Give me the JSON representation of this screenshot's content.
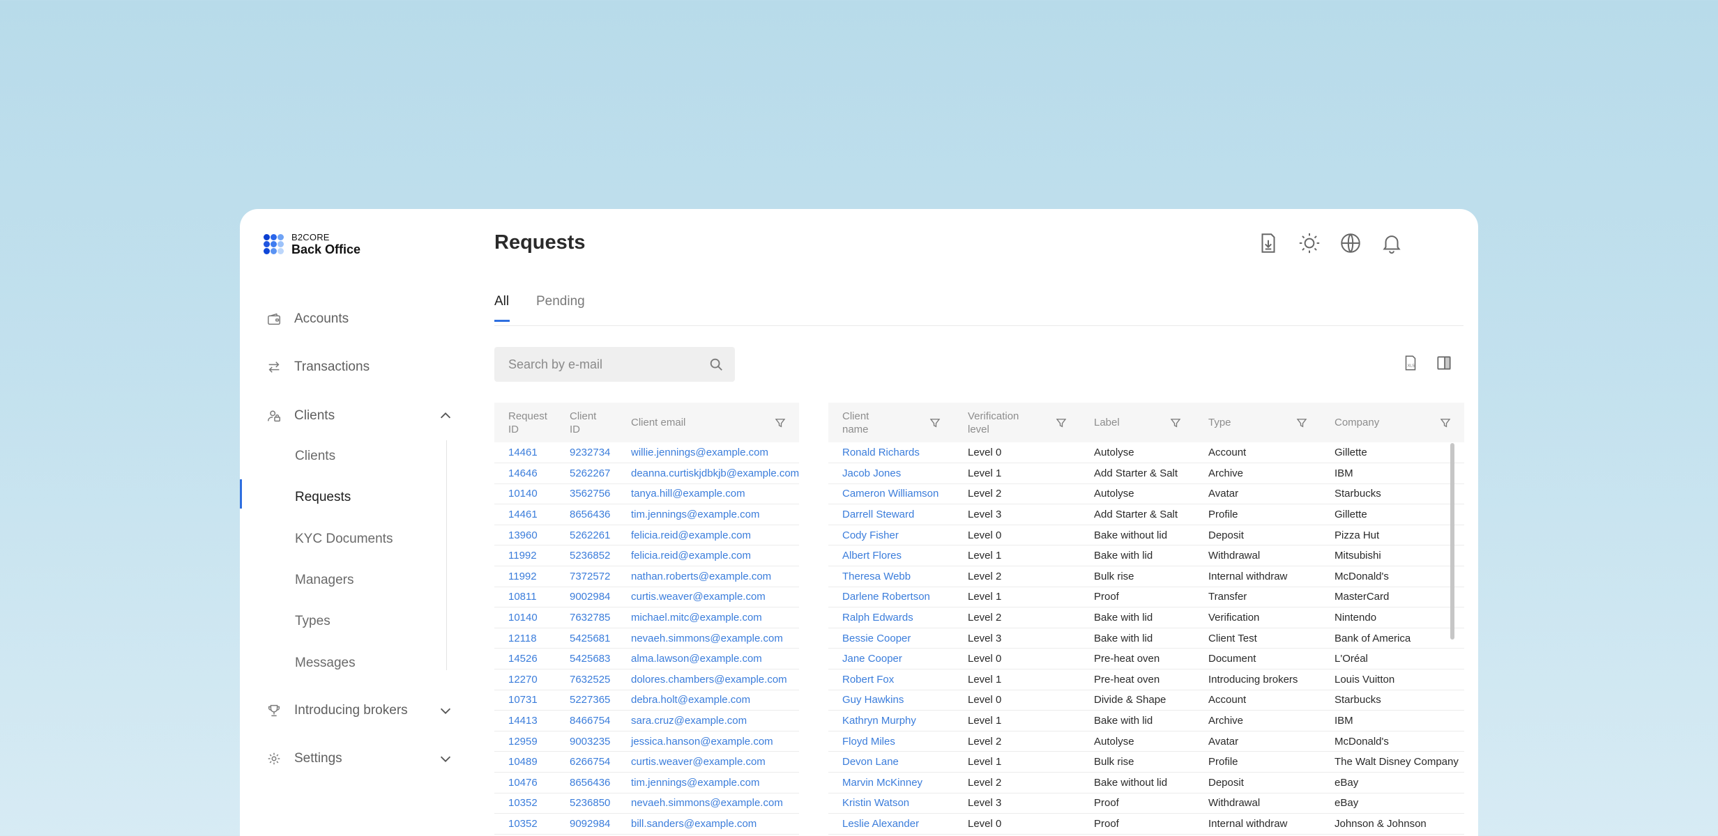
{
  "app": {
    "brand_small": "B2CORE",
    "brand_big": "Back Office"
  },
  "sidebar": {
    "items": [
      {
        "label": "Accounts",
        "icon": "wallet-icon"
      },
      {
        "label": "Transactions",
        "icon": "transfer-arrows-icon"
      },
      {
        "label": "Clients",
        "icon": "clients-icon",
        "expanded": true
      },
      {
        "label": "Introducing brokers",
        "icon": "trophy-icon",
        "expanded": false
      },
      {
        "label": "Settings",
        "icon": "gear-icon",
        "expanded": false
      }
    ],
    "clients_sub": [
      "Clients",
      "Requests",
      "KYC Documents",
      "Managers",
      "Types",
      "Messages"
    ],
    "active_sub": "Requests"
  },
  "header": {
    "title": "Requests",
    "icons": [
      "download-document-icon",
      "sun-icon",
      "globe-icon",
      "bell-icon"
    ]
  },
  "tabs": [
    {
      "label": "All",
      "active": true
    },
    {
      "label": "Pending",
      "active": false
    }
  ],
  "search": {
    "placeholder": "Search by e-mail",
    "value": ""
  },
  "toolbar": {
    "icons": [
      "xls-export-icon",
      "columns-icon"
    ]
  },
  "table": {
    "columns_left": [
      "Request ID",
      "Client ID",
      "Client email"
    ],
    "columns_right": [
      "Client name",
      "Verification level",
      "Label",
      "Type",
      "Company"
    ],
    "rows": [
      [
        "14461",
        "9232734",
        "willie.jennings@example.com",
        "Ronald Richards",
        "Level 0",
        "Autolyse",
        "Account",
        "Gillette"
      ],
      [
        "14646",
        "5262267",
        "deanna.curtiskjdbkjb@example.com",
        "Jacob Jones",
        "Level 1",
        "Add Starter & Salt",
        "Archive",
        "IBM"
      ],
      [
        "10140",
        "3562756",
        "tanya.hill@example.com",
        "Cameron Williamson",
        "Level 2",
        "Autolyse",
        "Avatar",
        "Starbucks"
      ],
      [
        "14461",
        "8656436",
        "tim.jennings@example.com",
        "Darrell Steward",
        "Level 3",
        "Add Starter & Salt",
        "Profile",
        "Gillette"
      ],
      [
        "13960",
        "5262261",
        "felicia.reid@example.com",
        "Cody Fisher",
        "Level 0",
        "Bake without lid",
        "Deposit",
        "Pizza Hut"
      ],
      [
        "11992",
        "5236852",
        "felicia.reid@example.com",
        "Albert Flores",
        "Level 1",
        "Bake with lid",
        "Withdrawal",
        "Mitsubishi"
      ],
      [
        "11992",
        "7372572",
        "nathan.roberts@example.com",
        "Theresa Webb",
        "Level 2",
        "Bulk rise",
        "Internal withdraw",
        "McDonald's"
      ],
      [
        "10811",
        "9002984",
        "curtis.weaver@example.com",
        "Darlene Robertson",
        "Level 1",
        "Proof",
        "Transfer",
        "MasterCard"
      ],
      [
        "10140",
        "7632785",
        "michael.mitc@example.com",
        "Ralph Edwards",
        "Level 2",
        "Bake with lid",
        "Verification",
        "Nintendo"
      ],
      [
        "12118",
        "5425681",
        "nevaeh.simmons@example.com",
        "Bessie Cooper",
        "Level 3",
        "Bake with lid",
        "Client Test",
        "Bank of America"
      ],
      [
        "14526",
        "5425683",
        "alma.lawson@example.com",
        "Jane Cooper",
        "Level 0",
        "Pre-heat oven",
        "Document",
        "L'Oréal"
      ],
      [
        "12270",
        "7632525",
        "dolores.chambers@example.com",
        "Robert Fox",
        "Level 1",
        "Pre-heat oven",
        "Introducing brokers",
        "Louis Vuitton"
      ],
      [
        "10731",
        "5227365",
        "debra.holt@example.com",
        "Guy Hawkins",
        "Level 0",
        "Divide & Shape",
        "Account",
        "Starbucks"
      ],
      [
        "14413",
        "8466754",
        "sara.cruz@example.com",
        "Kathryn Murphy",
        "Level 1",
        "Bake with lid",
        "Archive",
        "IBM"
      ],
      [
        "12959",
        "9003235",
        "jessica.hanson@example.com",
        "Floyd Miles",
        "Level 2",
        "Autolyse",
        "Avatar",
        "McDonald's"
      ],
      [
        "10489",
        "6266754",
        "curtis.weaver@example.com",
        "Devon Lane",
        "Level 1",
        "Bulk rise",
        "Profile",
        "The Walt Disney Company"
      ],
      [
        "10476",
        "8656436",
        "tim.jennings@example.com",
        "Marvin McKinney",
        "Level 2",
        "Bake without lid",
        "Deposit",
        "eBay"
      ],
      [
        "10352",
        "5236850",
        "nevaeh.simmons@example.com",
        "Kristin Watson",
        "Level 3",
        "Proof",
        "Withdrawal",
        "eBay"
      ],
      [
        "10352",
        "9092984",
        "bill.sanders@example.com",
        "Leslie Alexander",
        "Level 0",
        "Proof",
        "Internal withdraw",
        "Johnson & Johnson"
      ]
    ]
  },
  "colors": {
    "accent": "#2f6fe0",
    "link": "#3b7ddb",
    "logo": [
      "#0b3fd1",
      "#2a66ea",
      "#6fa3f5",
      "#1f55e0",
      "#3e7cf0",
      "#9cc2fa",
      "#0f47d8",
      "#5a93f3",
      "#bcd6fb"
    ]
  }
}
